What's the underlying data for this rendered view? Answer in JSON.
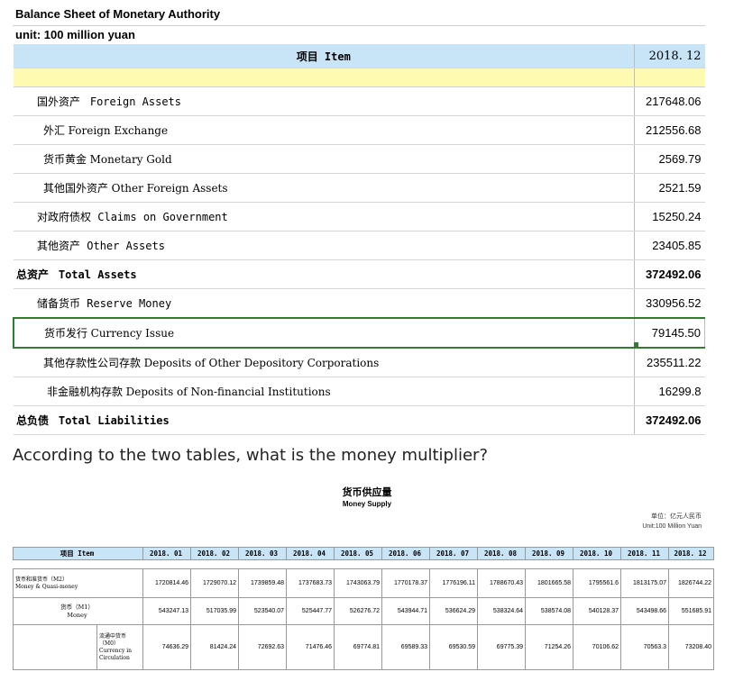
{
  "balance_sheet": {
    "title": "Balance Sheet of Monetary Authority",
    "unit": "unit: 100 million yuan",
    "header_item": "项目  Item",
    "header_value": "2018. 12",
    "rows": [
      {
        "zh": "国外资产",
        "en": "Foreign Assets",
        "value": "217648.06"
      },
      {
        "zh": "外汇",
        "en": "Foreign Exchange",
        "value": "212556.68"
      },
      {
        "zh": "货币黄金",
        "en": "Monetary Gold",
        "value": "2569.79"
      },
      {
        "zh": "其他国外资产",
        "en": "Other Foreign Assets",
        "value": "2521.59"
      },
      {
        "zh": "对政府债权",
        "en": "Claims on Government",
        "value": "15250.24"
      },
      {
        "zh": "其他资产",
        "en": "Other Assets",
        "value": "23405.85"
      },
      {
        "zh": "总资产",
        "en": "Total Assets",
        "value": "372492.06"
      },
      {
        "zh": "储备货币",
        "en": "Reserve Money",
        "value": "330956.52"
      },
      {
        "zh": "货币发行",
        "en": "Currency Issue",
        "value": "79145.50"
      },
      {
        "zh": "其他存款性公司存款",
        "en": "Deposits of Other Depository Corporations",
        "value": "235511.22"
      },
      {
        "zh": "非金融机构存款",
        "en": "Deposits of Non-financial Institutions",
        "value": "16299.8"
      },
      {
        "zh": "总负债",
        "en": "Total Liabilities",
        "value": "372492.06"
      }
    ]
  },
  "question": "According to the two tables, what is the money multiplier?",
  "money_supply": {
    "title": "货币供应量",
    "subtitle": "Money Supply",
    "unit_zh": "单位：亿元人民币",
    "unit_en": "Unit:100 Million Yuan",
    "header_item": "项目 Item",
    "months": [
      "2018. 01",
      "2018. 02",
      "2018. 03",
      "2018. 04",
      "2018. 05",
      "2018. 06",
      "2018. 07",
      "2018. 08",
      "2018. 09",
      "2018. 10",
      "2018. 11",
      "2018. 12"
    ],
    "m2_label_zh": "货币和准货币（M2）",
    "m2_label_en": "Money & Quasi-money",
    "m2": [
      "1720814.46",
      "1729070.12",
      "1739859.48",
      "1737683.73",
      "1743063.79",
      "1770178.37",
      "1776196.11",
      "1788670.43",
      "1801665.58",
      "1795561.6",
      "1813175.07",
      "1826744.22"
    ],
    "m1_label_zh": "货币（M1）",
    "m1_label_en": "Money",
    "m1": [
      "543247.13",
      "517035.99",
      "523540.07",
      "525447.77",
      "526276.72",
      "543944.71",
      "536624.29",
      "538324.64",
      "538574.08",
      "540128.37",
      "543498.66",
      "551685.91"
    ],
    "m0_label_zh": "流通中货币",
    "m0_label_code": "（M0）",
    "m0_label_en": "Currency in Circulation",
    "m0": [
      "74636.29",
      "81424.24",
      "72692.63",
      "71476.46",
      "69774.81",
      "69589.33",
      "69530.59",
      "69775.39",
      "71254.26",
      "70106.62",
      "70563.3",
      "73208.40"
    ]
  }
}
